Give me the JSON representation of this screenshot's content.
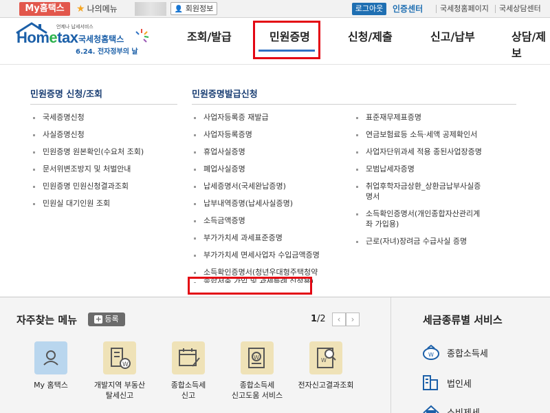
{
  "topbar": {
    "my_hometax": "My홈택스",
    "my_menu": "나의메뉴",
    "member_info": "회원정보",
    "logout": "로그아웃",
    "cert_center": "인증센터",
    "links": [
      "국세청홈페이지",
      "국세상담센터"
    ]
  },
  "header": {
    "logo_small": "언제나 납세서비스",
    "logo_main_a": "Hom",
    "logo_main_e": "e",
    "logo_main_b": "tax",
    "logo_name": "국세청홈택스",
    "logo_sub": "6.24. 전자정부의 날",
    "nav": [
      "조회/발급",
      "민원증명",
      "신청/제출",
      "신고/납부",
      "상담/제보"
    ],
    "active_nav": "민원증명"
  },
  "megamenu": {
    "col1": {
      "title": "민원증명 신청/조회",
      "items": [
        "국세증명신청",
        "사실증명신청",
        "민원증명 원본확인(수요처 조회)",
        "문서위변조방지 및 처벌안내",
        "민원증명 민원신청결과조회",
        "민원실 대기인원 조회"
      ]
    },
    "col2": {
      "title": "민원증명발급신청",
      "items": [
        "사업자등록증 재발급",
        "사업자등록증명",
        "휴업사실증명",
        "폐업사실증명",
        "납세증명서(국세완납증명)",
        "납부내역증명(납세사실증명)",
        "소득금액증명",
        "부가가치세 과세표준증명",
        "부가가치세 면세사업자 수입금액증명",
        "소득확인증명서(청년우대형주택청약",
        "종합저축 가입 및 과세특례 신청용)"
      ]
    },
    "col3": {
      "items": [
        "표준재무제표증명",
        "연금보험료등 소득·세액 공제확인서",
        "사업자단위과세 적용 종된사업장증명",
        "모범납세자증명",
        "취업후학자금상환_상환금납부사실증",
        "명서",
        "소득확인증명서(개인종합자산관리계",
        "좌 가입용)",
        "근로(자녀)장려금 수급사실 증명"
      ]
    },
    "highlighted_item": "소득금액증명"
  },
  "favorites": {
    "title": "자주찾는 메뉴",
    "register": "등록",
    "page_current": "1",
    "page_total": "/2",
    "items": [
      {
        "icon": "person-icon",
        "line1": "My 홈택스",
        "line2": ""
      },
      {
        "icon": "building-won-icon",
        "line1": "개발지역 부동산",
        "line2": "탈세신고"
      },
      {
        "icon": "calendar-doc-icon",
        "line1": "종합소득세",
        "line2": "신고"
      },
      {
        "icon": "doc-won-icon",
        "line1": "종합소득세",
        "line2": "신고도움 서비스"
      },
      {
        "icon": "doc-search-icon",
        "line1": "전자신고결과조회",
        "line2": ""
      }
    ]
  },
  "tax_services": {
    "title": "세금종류별 서비스",
    "items": [
      {
        "icon": "money-bag-icon",
        "label": "종합소득세"
      },
      {
        "icon": "building-icon",
        "label": "법인세"
      },
      {
        "icon": "tax-icon",
        "label": "소비제세"
      }
    ]
  },
  "colors": {
    "accent_red": "#e30613",
    "brand_blue": "#1b5fa8",
    "my_hometax_bg": "#e2574c",
    "logout_bg": "#1f6fb2"
  }
}
